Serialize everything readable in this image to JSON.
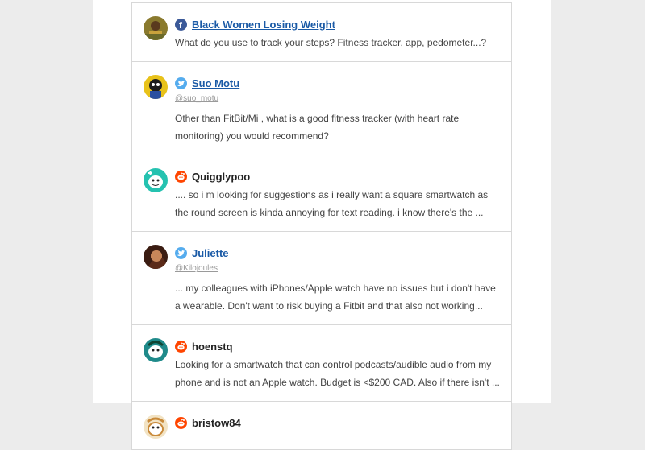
{
  "posts": [
    {
      "source": "facebook",
      "name": "Black Women Losing Weight",
      "linked": true,
      "text": "What do you use to track your steps? Fitness tracker, app, pedometer...?"
    },
    {
      "source": "twitter",
      "name": "Suo Motu",
      "linked": true,
      "handle": "@suo_motu",
      "text": "Other than FitBit/Mi , what is a good fitness tracker (with heart rate monitoring) you would recommend?"
    },
    {
      "source": "reddit",
      "name": "Quigglypoo",
      "linked": false,
      "text": ".... so i m looking for suggestions as i really want a square smartwatch as the round screen is kinda annoying for text reading. i know there's the ..."
    },
    {
      "source": "twitter",
      "name": "Juliette",
      "linked": true,
      "handle": "@Kilojoules",
      "text": "... my colleagues with iPhones/Apple watch have no issues but i don't have a wearable. Don't want to risk buying a Fitbit and that also not working..."
    },
    {
      "source": "reddit",
      "name": "hoenstq",
      "linked": false,
      "text": "Looking for a smartwatch that can control podcasts/audible audio from my phone and is not an Apple watch. Budget is <$200 CAD. Also if there isn't ..."
    },
    {
      "source": "reddit",
      "name": "bristow84",
      "linked": false,
      "text": ""
    }
  ],
  "colors": {
    "facebook": "#3b5998",
    "twitter": "#55acee",
    "reddit": "#ff4500",
    "link": "#1a5aa6"
  }
}
